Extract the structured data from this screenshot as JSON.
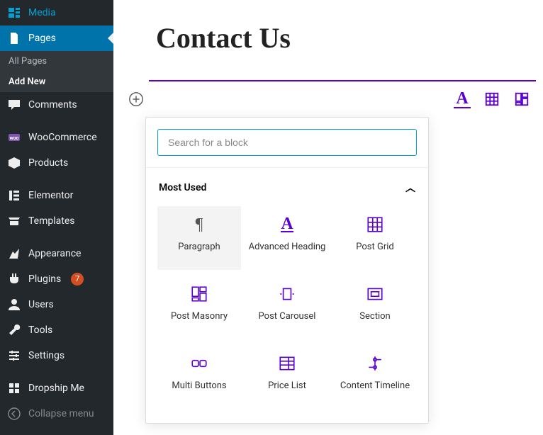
{
  "sidebar": {
    "items": [
      {
        "label": "Media",
        "icon": "media"
      },
      {
        "label": "Pages",
        "icon": "pages",
        "active": true
      },
      {
        "label": "Comments",
        "icon": "comments"
      },
      {
        "label": "WooCommerce",
        "icon": "woo"
      },
      {
        "label": "Products",
        "icon": "products"
      },
      {
        "label": "Elementor",
        "icon": "elementor"
      },
      {
        "label": "Templates",
        "icon": "templates"
      },
      {
        "label": "Appearance",
        "icon": "appearance"
      },
      {
        "label": "Plugins",
        "icon": "plugins",
        "badge": "7"
      },
      {
        "label": "Users",
        "icon": "users"
      },
      {
        "label": "Tools",
        "icon": "tools"
      },
      {
        "label": "Settings",
        "icon": "settings"
      },
      {
        "label": "Dropship Me",
        "icon": "dropship"
      },
      {
        "label": "Collapse menu",
        "icon": "collapse"
      }
    ],
    "submenu": {
      "all_pages": "All Pages",
      "add_new": "Add New"
    }
  },
  "page": {
    "title": "Contact Us"
  },
  "inserter": {
    "search_placeholder": "Search for a block",
    "section_title": "Most Used",
    "blocks": [
      {
        "label": "Paragraph",
        "icon": "paragraph",
        "selected": true
      },
      {
        "label": "Advanced Heading",
        "icon": "heading"
      },
      {
        "label": "Post Grid",
        "icon": "grid"
      },
      {
        "label": "Post Masonry",
        "icon": "masonry"
      },
      {
        "label": "Post Carousel",
        "icon": "carousel"
      },
      {
        "label": "Section",
        "icon": "section"
      },
      {
        "label": "Multi Buttons",
        "icon": "buttons"
      },
      {
        "label": "Price List",
        "icon": "pricelist"
      },
      {
        "label": "Content Timeline",
        "icon": "timeline"
      }
    ]
  }
}
